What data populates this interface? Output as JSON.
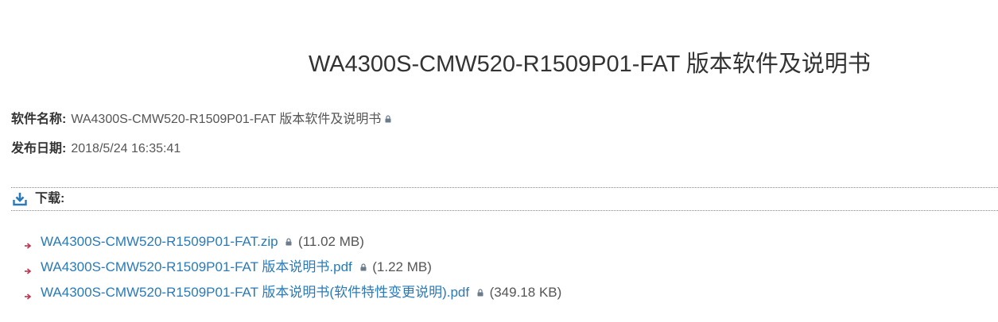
{
  "title": "WA4300S-CMW520-R1509P01-FAT 版本软件及说明书",
  "info": {
    "software_name_label": "软件名称:",
    "software_name_value": "WA4300S-CMW520-R1509P01-FAT 版本软件及说明书",
    "release_date_label": "发布日期:",
    "release_date_value": "2018/5/24 16:35:41"
  },
  "download": {
    "label": "下载:",
    "icon": "download-icon",
    "files": [
      {
        "name": "WA4300S-CMW520-R1509P01-FAT.zip",
        "size": "(11.02 MB)"
      },
      {
        "name": "WA4300S-CMW520-R1509P01-FAT 版本说明书.pdf",
        "size": "(1.22 MB)"
      },
      {
        "name": "WA4300S-CMW520-R1509P01-FAT 版本说明书(软件特性变更说明).pdf",
        "size": "(349.18 KB)"
      }
    ]
  },
  "colors": {
    "link": "#2a7ab8",
    "arrow": "#c0334d",
    "download_icon": "#2a7ab8",
    "lock": "#6a7b8c"
  }
}
